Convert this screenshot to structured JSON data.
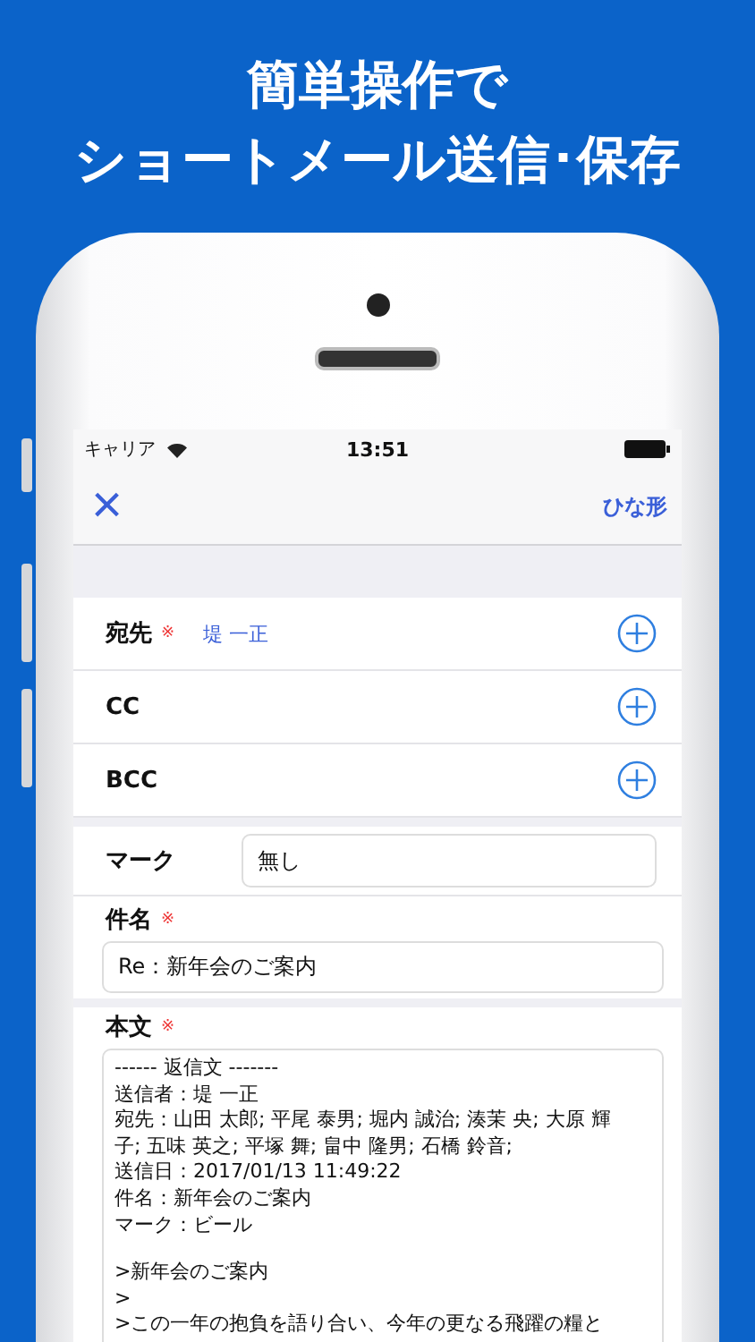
{
  "headline": [
    "簡単操作で",
    "ショートメール送信･保存"
  ],
  "status_bar": {
    "carrier": "キャリア",
    "time": "13:51"
  },
  "nav": {
    "close": "×",
    "template_button": "ひな形"
  },
  "recipients": [
    {
      "label": "宛先",
      "required_mark": "※",
      "value": "堤 一正"
    },
    {
      "label": "CC"
    },
    {
      "label": "BCC"
    }
  ],
  "mark": {
    "label": "マーク",
    "value": "無し"
  },
  "subject": {
    "label": "件名",
    "required_mark": "※",
    "value": "Re：新年会のご案内"
  },
  "body": {
    "label": "本文",
    "required_mark": "※",
    "paragraphs": [
      [
        "------ 返信文 -------",
        "送信者：堤 一正",
        "宛先：山田 太郎; 平尾 泰男; 堀内 誠治; 湊茉 央; 大原 輝",
        "子; 五味 英之; 平塚 舞; 畠中 隆男; 石橋 鈴音;",
        "送信日：2017/01/13 11:49:22",
        "件名：新年会のご案内",
        "マーク：ビール"
      ],
      [
        ">新年会のご案内",
        ">",
        ">この一年の抱負を語り合い、今年の更なる飛躍の糧と"
      ]
    ]
  }
}
